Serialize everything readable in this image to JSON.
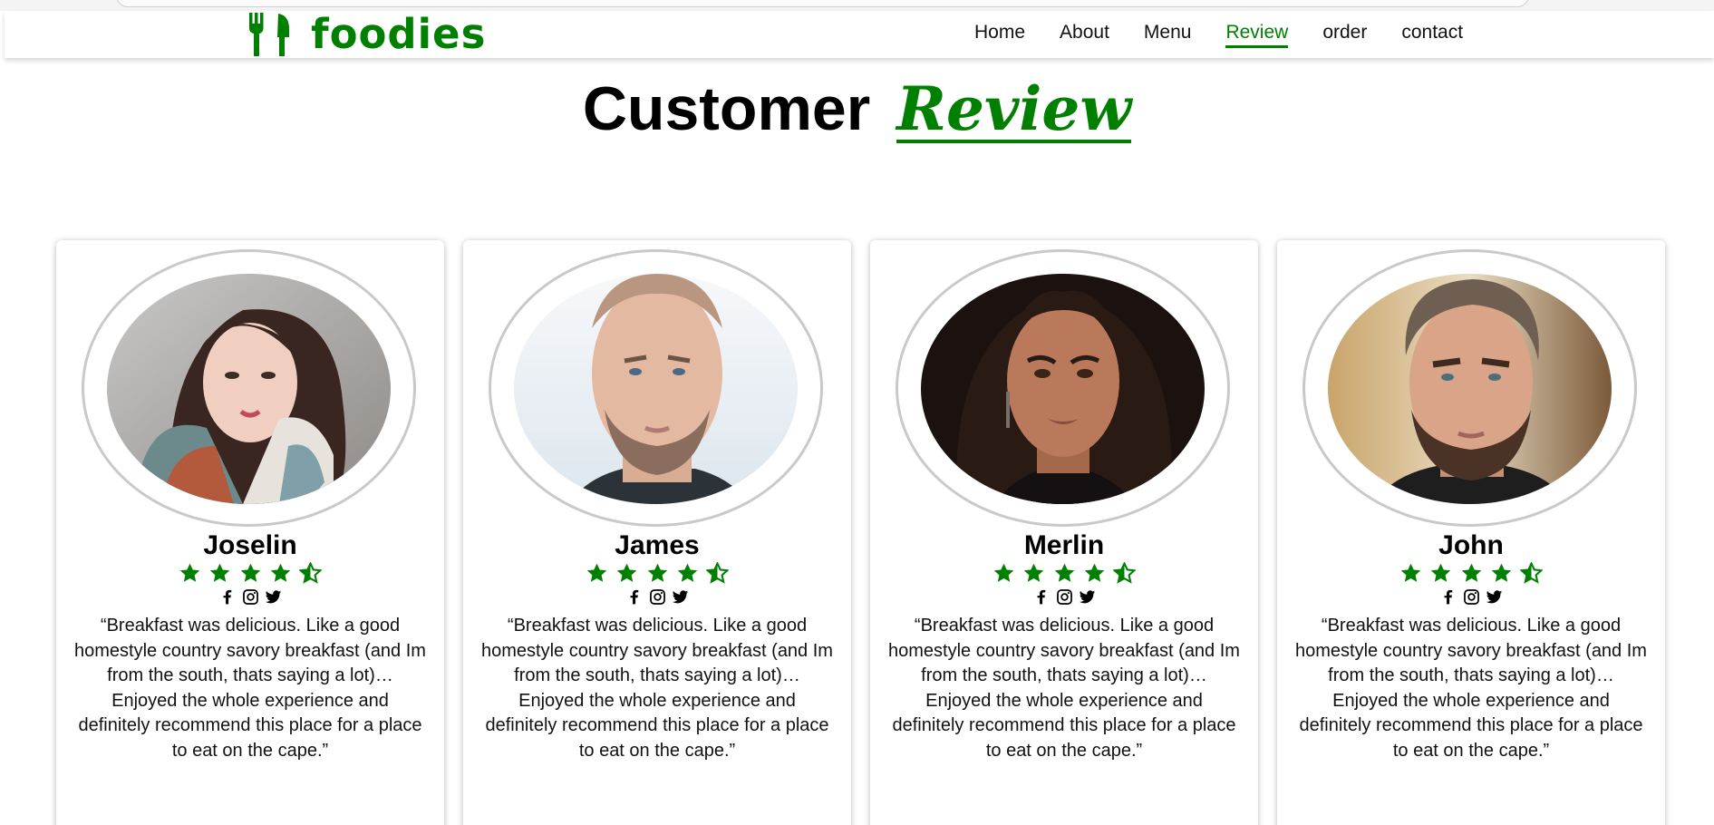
{
  "nav": {
    "brand": "foodies",
    "links": [
      "Home",
      "About",
      "Menu",
      "Review",
      "order",
      "contact"
    ],
    "active": "Review"
  },
  "section": {
    "title_main": "Customer",
    "title_accent": "Review"
  },
  "reviews": [
    {
      "name": "Joselin",
      "rating": 4.5,
      "text": "“Breakfast was delicious. Like a good homestyle country savory breakfast (and Im from the south, thats saying a lot)… Enjoyed the whole experience and definitely recommend this place for a place to eat on the cape.”"
    },
    {
      "name": "James",
      "rating": 4.5,
      "text": "“Breakfast was delicious. Like a good homestyle country savory breakfast (and Im from the south, thats saying a lot)… Enjoyed the whole experience and definitely recommend this place for a place to eat on the cape.”"
    },
    {
      "name": "Merlin",
      "rating": 4.5,
      "text": "“Breakfast was delicious. Like a good homestyle country savory breakfast (and Im from the south, thats saying a lot)… Enjoyed the whole experience and definitely recommend this place for a place to eat on the cape.”"
    },
    {
      "name": "John",
      "rating": 4.5,
      "text": "“Breakfast was delicious. Like a good homestyle country savory breakfast (and Im from the south, thats saying a lot)… Enjoyed the whole experience and definitely recommend this place for a place to eat on the cape.”"
    }
  ],
  "social_icons": [
    "facebook-icon",
    "instagram-icon",
    "twitter-icon"
  ],
  "colors": {
    "accent": "#008000",
    "text": "#111111",
    "ring": "#c9c9c9"
  }
}
